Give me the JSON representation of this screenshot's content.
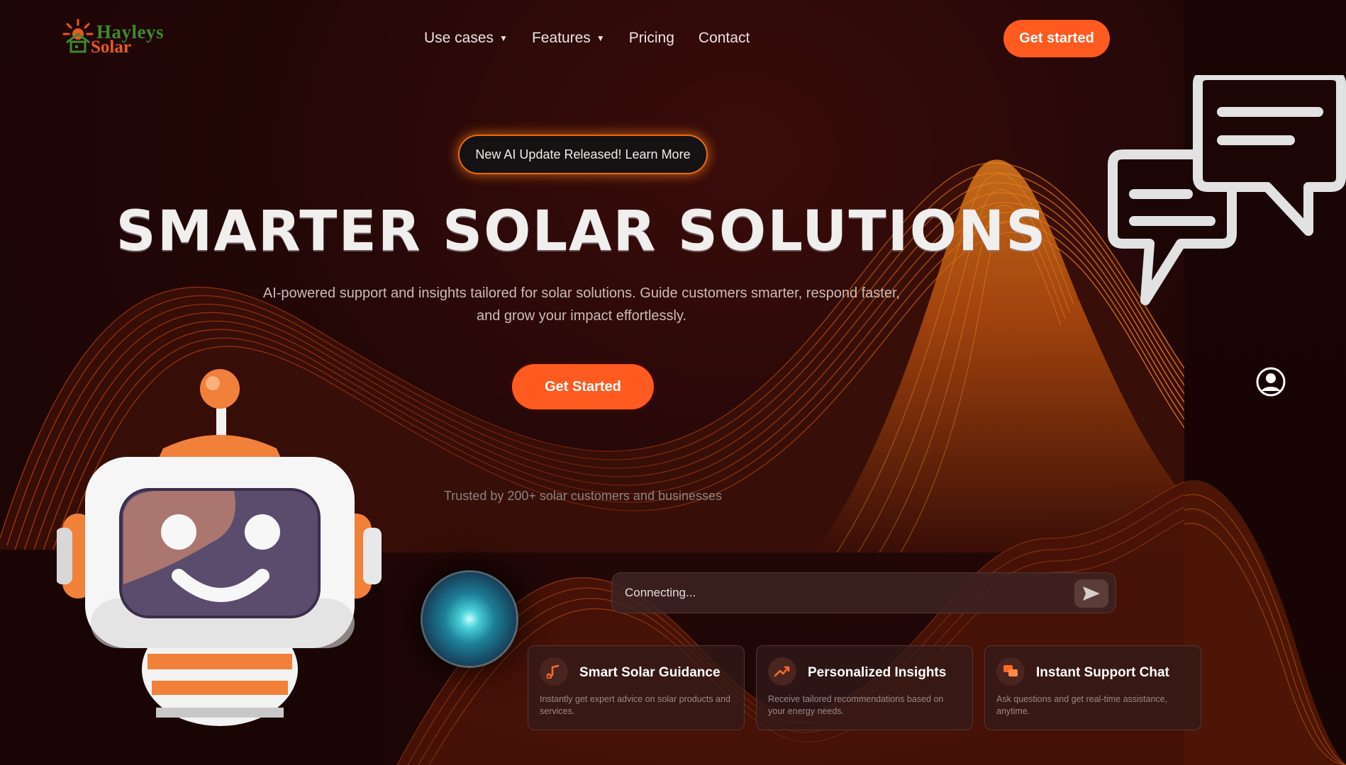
{
  "brand": {
    "name_line1": "Hayleys",
    "name_line2": "Solar"
  },
  "nav": {
    "items": [
      {
        "label": "Use cases",
        "dropdown": true
      },
      {
        "label": "Features",
        "dropdown": true
      },
      {
        "label": "Pricing",
        "dropdown": false
      },
      {
        "label": "Contact",
        "dropdown": false
      }
    ],
    "cta_label": "Get started"
  },
  "hero": {
    "announcement": "New AI Update Released! Learn More",
    "title": "SMARTER SOLAR SOLUTIONS",
    "subtitle": "AI-powered support and insights tailored for solar solutions. Guide customers smarter, respond faster, and grow your impact effortlessly.",
    "cta_label": "Get Started",
    "trusted_text": "Trusted by 200+ solar customers and businesses"
  },
  "chat": {
    "input_placeholder": "Connecting...",
    "send_icon": "send-icon"
  },
  "features": [
    {
      "icon": "music-note-icon",
      "title": "Smart Solar Guidance",
      "description": "Instantly get expert advice on solar products and services."
    },
    {
      "icon": "trend-up-icon",
      "title": "Personalized Insights",
      "description": "Receive tailored recommendations based on your energy needs."
    },
    {
      "icon": "chat-bubbles-icon",
      "title": "Instant Support Chat",
      "description": "Ask questions and get real-time assistance, anytime."
    }
  ],
  "colors": {
    "accent": "#ff5a1f",
    "background": "#1f0606",
    "logo_green": "#3d8a2c",
    "logo_orange": "#e55a1f"
  }
}
